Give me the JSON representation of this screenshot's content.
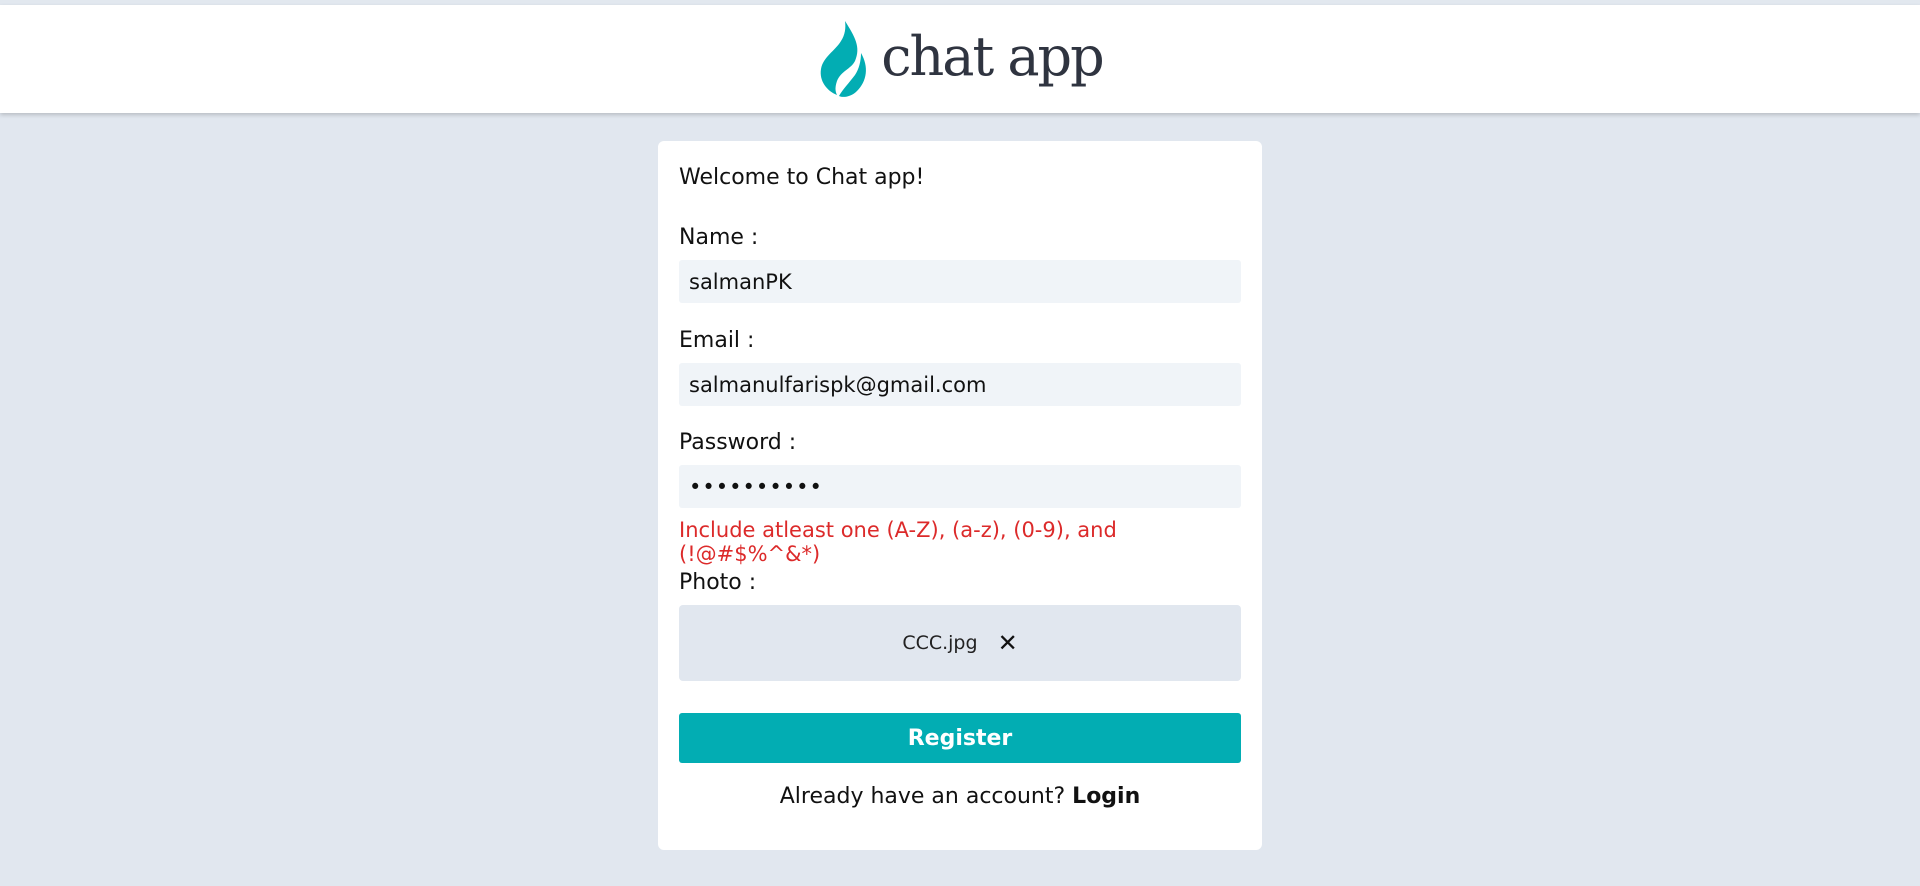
{
  "app": {
    "logo_text": "chat app",
    "brand_color": "#02adb3"
  },
  "form": {
    "welcome": "Welcome to Chat app!",
    "name_label": "Name :",
    "name_value": "salmanPK",
    "email_label": "Email :",
    "email_value": "salmanulfarispk@gmail.com",
    "password_label": "Password :",
    "password_value": "••••••••••",
    "password_error": "Include atleast one (A-Z), (a-z), (0-9), and (!@#$%^&*)",
    "photo_label": "Photo :",
    "photo_filename": "CCC.jpg",
    "remove_icon": "close-icon",
    "register_label": "Register",
    "login_prompt": "Already have an account?",
    "login_label": "Login"
  },
  "colors": {
    "page_background": "#e1e7ef",
    "input_background": "#f0f4f8",
    "error": "#dc2a2a",
    "button": "#02adb3"
  }
}
